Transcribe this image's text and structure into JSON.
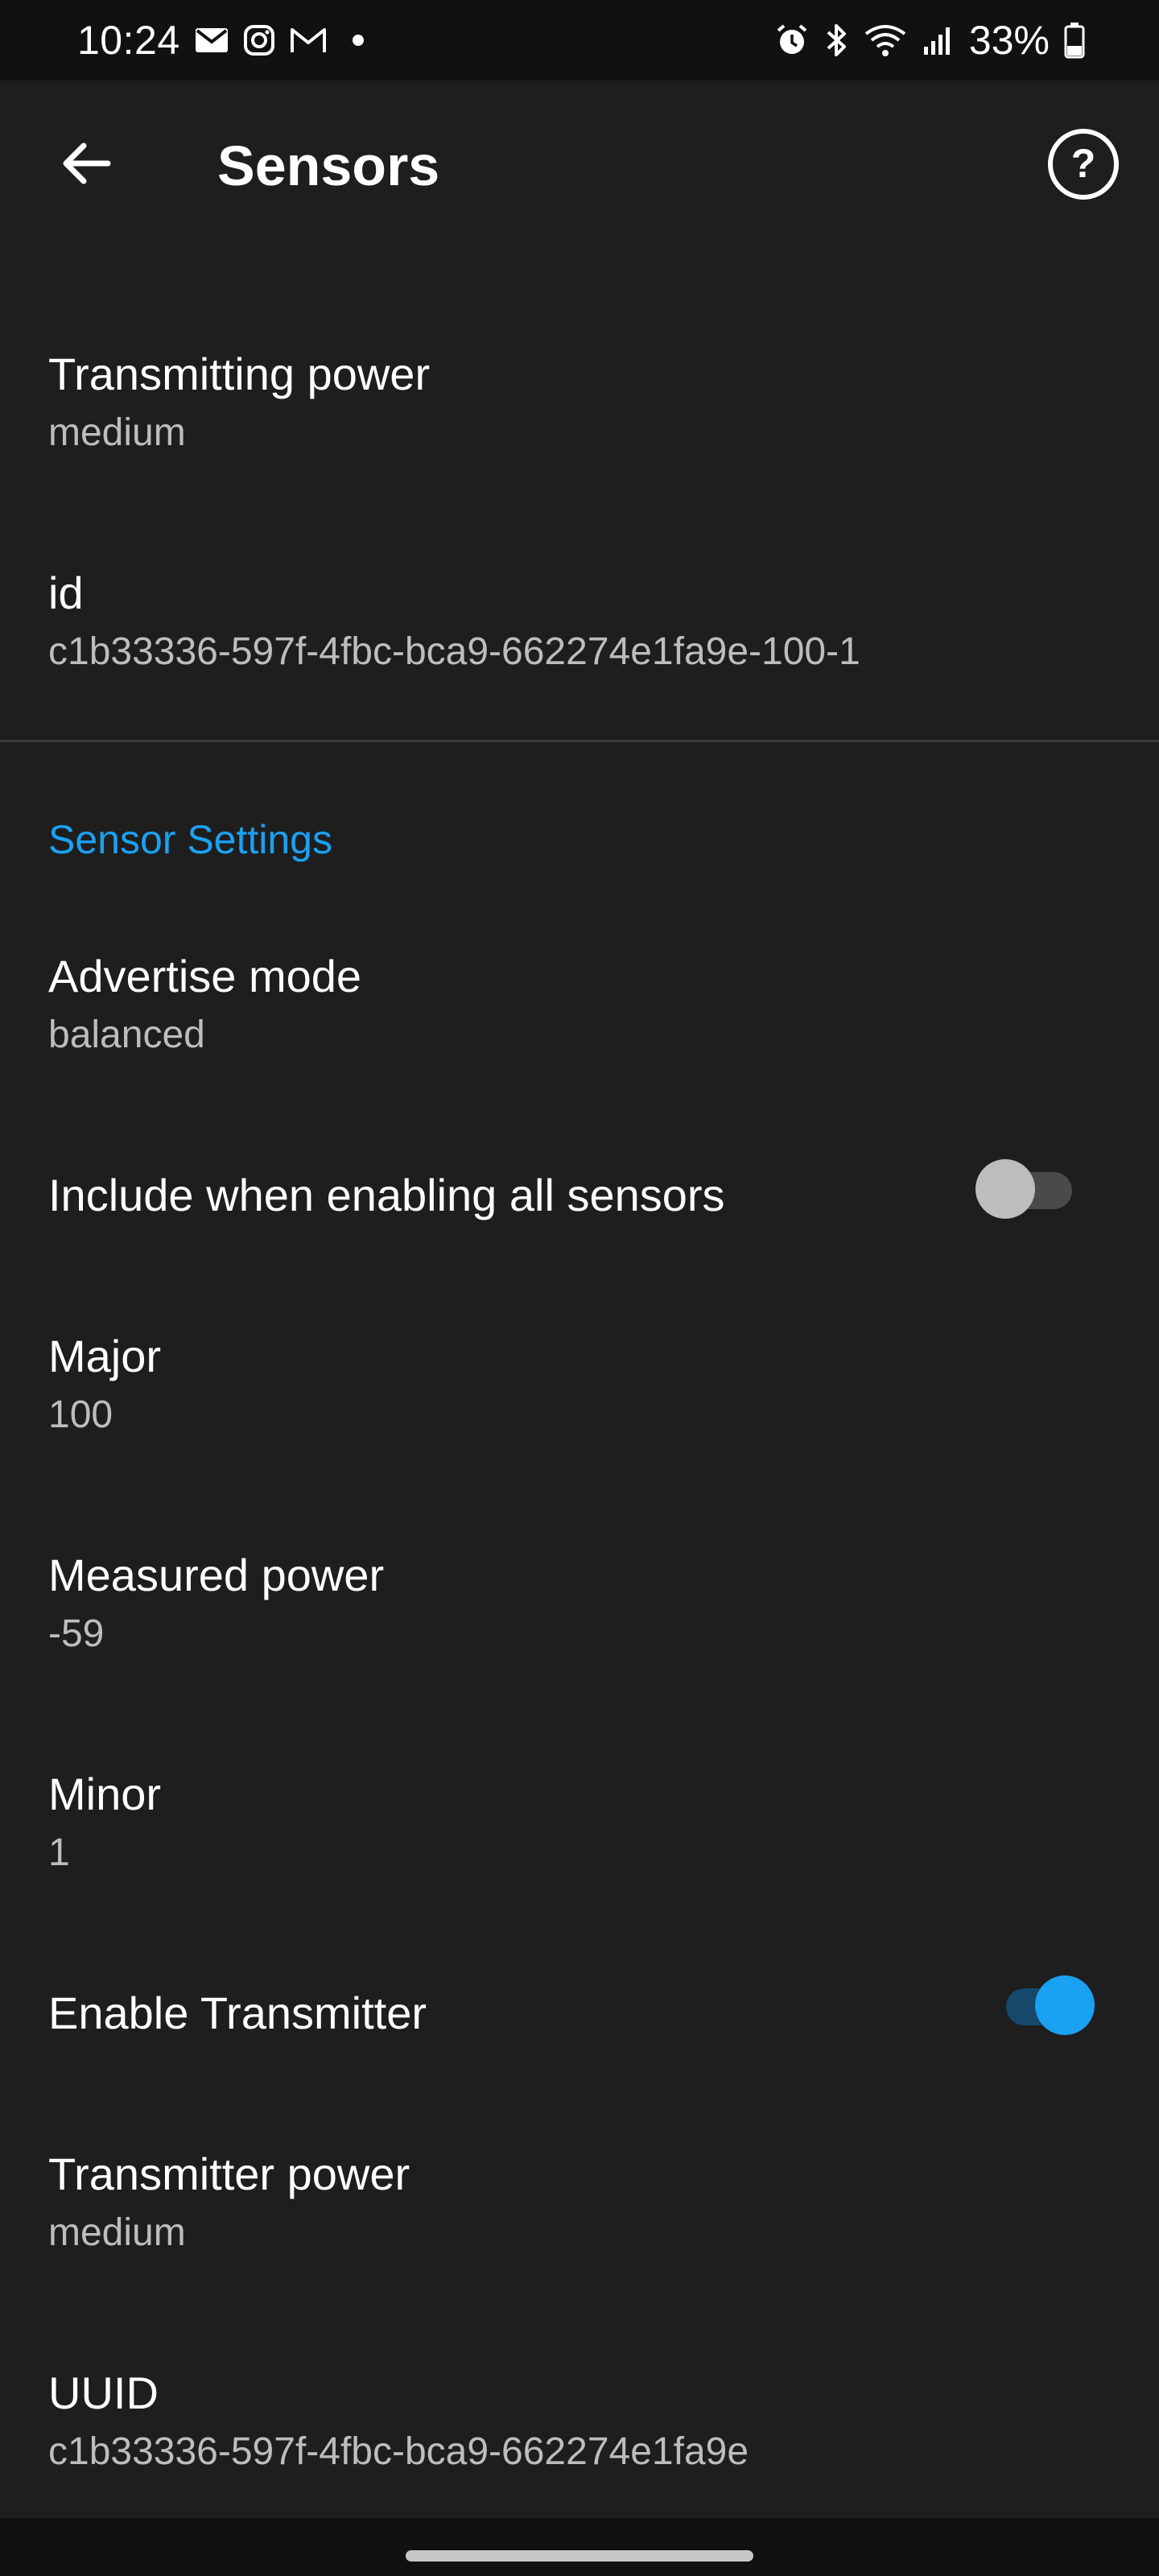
{
  "status_bar": {
    "time": "10:24",
    "left_icons": [
      "mail-icon",
      "instagram-icon",
      "gmail-icon"
    ],
    "right_icons": [
      "alarm-icon",
      "bluetooth-icon",
      "wifi-icon",
      "signal-icon"
    ],
    "battery": "33%"
  },
  "app_bar": {
    "title": "Sensors"
  },
  "items": [
    {
      "title": "Transmitting power",
      "subtitle": "medium"
    },
    {
      "title": "id",
      "subtitle": "c1b33336-597f-4fbc-bca9-662274e1fa9e-100-1"
    }
  ],
  "section": {
    "header": "Sensor Settings"
  },
  "settings": {
    "advertise_mode": {
      "title": "Advertise mode",
      "subtitle": "balanced"
    },
    "include_all": {
      "title": "Include when enabling all sensors",
      "enabled": false
    },
    "major": {
      "title": "Major",
      "subtitle": "100"
    },
    "measured_power": {
      "title": "Measured power",
      "subtitle": "-59"
    },
    "minor": {
      "title": "Minor",
      "subtitle": "1"
    },
    "enable_transmitter": {
      "title": "Enable Transmitter",
      "enabled": true
    },
    "transmitter_power": {
      "title": "Transmitter power",
      "subtitle": "medium"
    },
    "uuid": {
      "title": "UUID",
      "subtitle": "c1b33336-597f-4fbc-bca9-662274e1fa9e"
    }
  },
  "colors": {
    "background": "#1e1e1f",
    "accent": "#1ba1f2",
    "subtitle": "#bdbdbd"
  }
}
